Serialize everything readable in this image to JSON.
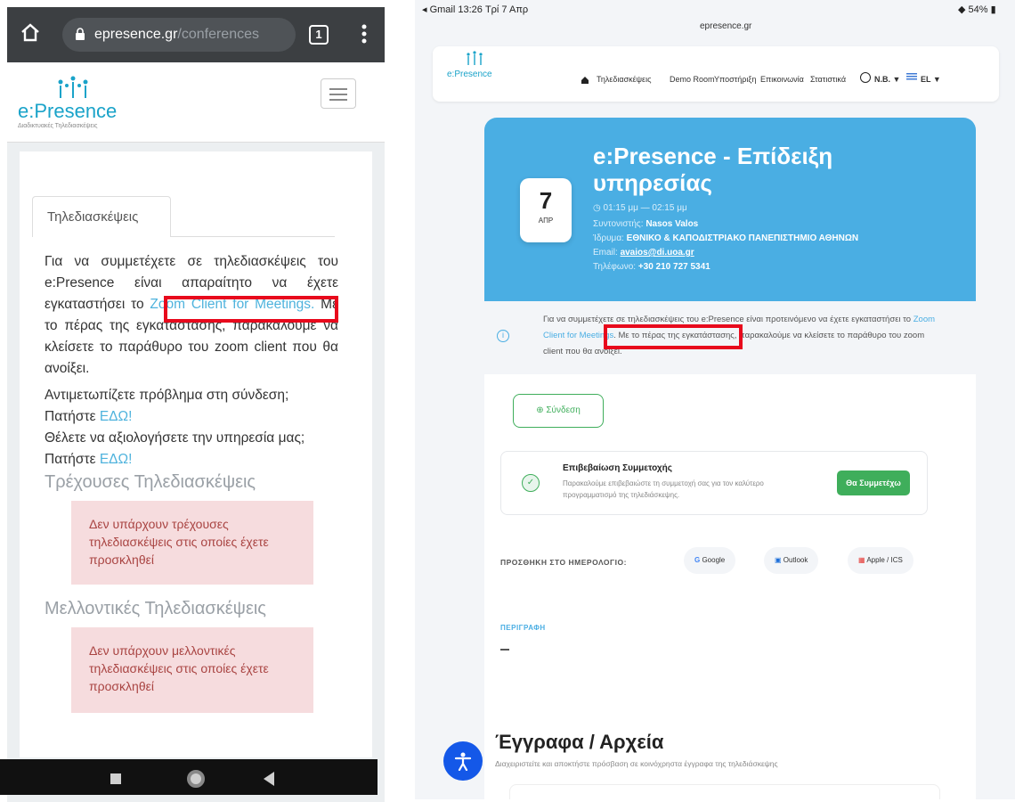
{
  "phone": {
    "browser": {
      "url_domain": "epresence.gr",
      "url_path": "/conferences",
      "tab_count": "1"
    },
    "logo": {
      "name": "e:Presence",
      "tagline": "Διαδικτυακές Τηλεδιασκέψεις"
    },
    "tab_label": "Τηλεδιασκέψεις",
    "intro": {
      "before_link": "Για να συμμετέχετε σε τηλεδιασκέψεις του e:Presence είναι απαραίτητο να έχετε εγκαταστήσει το ",
      "link": "Zoom Client for Meetings.",
      "after_link": " Με το πέρας της εγκατάστασης, παρακαλούμε να κλείσετε το παράθυρο του zoom client που θα ανοίξει."
    },
    "help": {
      "problem_text": "Αντιμετωπίζετε πρόβλημα στη σύνδεση;",
      "problem_press": "Πατήστε ",
      "problem_link": "ΕΔΩ!",
      "rate_text": "Θέλετε να αξιολογήσετε την υπηρεσία μας;",
      "rate_press": "Πατήστε ",
      "rate_link": "ΕΔΩ!"
    },
    "current_title": "Τρέχουσες Τηλεδιασκέψεις",
    "current_empty": "Δεν υπάρχουν τρέχουσες τηλεδιασκέψεις στις οποίες έχετε προσκληθεί",
    "future_title": "Μελλοντικές Τηλεδιασκέψεις",
    "future_empty": "Δεν υπάρχουν μελλοντικές τηλεδιασκέψεις στις οποίες έχετε προσκληθεί"
  },
  "tablet": {
    "status": {
      "left": "◂ Gmail 13:26 Τρί 7 Απρ",
      "right": "54%",
      "url": "epresence.gr"
    },
    "logo": "e:Presence",
    "nav": [
      "Τηλεδιασκέψεις",
      "Demo Room",
      "Υποστήριξη",
      "Επικοινωνία",
      "Στατιστικά",
      "N.B.",
      "EL"
    ],
    "event": {
      "day": "7",
      "month": "ΑΠΡ",
      "title": "e:Presence - Επίδειξη υπηρεσίας",
      "time": "01:15 μμ — 02:15 μμ",
      "coordinator_label": "Συντονιστής: ",
      "coordinator": "Nasos Valos",
      "institution_label": "Ίδρυμα: ",
      "institution": "ΕΘΝΙΚΟ & ΚΑΠΟΔΙΣΤΡΙΑΚΟ ΠΑΝΕΠΙΣΤΗΜΙΟ ΑΘΗΝΩΝ",
      "email_label": "Email: ",
      "email": "avaios@di.uoa.gr",
      "phone_label": "Τηλέφωνο: ",
      "phone": "+30 210 727 5341"
    },
    "info": {
      "before_link": "Για να συμμετέχετε σε τηλεδιασκέψεις του e:Presence είναι προτεινόμενο να έχετε εγκαταστήσει το ",
      "link": "Zoom Client for Meetings",
      "after_link": ". Με το πέρας της εγκατάστασης, παρακαλούμε να κλείσετε το παράθυρο του zoom client που θα ανοίξει."
    },
    "join_label": "Σύνδεση",
    "confirm": {
      "title": "Επιβεβαίωση Συμμετοχής",
      "text": "Παρακαλούμε επιβεβαιώστε τη συμμετοχή σας για τον καλύτερο προγραμματισμό της τηλεδιάσκεψης.",
      "button": "Θα Συμμετέχω"
    },
    "calendar": {
      "label": "ΠΡΟΣΘΗΚΗ ΣΤΟ ΗΜΕΡΟΛΟΓΙΟ:",
      "google": "Google",
      "outlook": "Outlook",
      "apple": "Apple / ICS"
    },
    "description_label": "ΠΕΡΙΓΡΑΦΗ",
    "files": {
      "title": "Έγγραφα / Αρχεία",
      "subtitle": "Διαχειριστείτε και αποκτήστε πρόσβαση σε κοινόχρηστα έγγραφα της τηλεδιάσκεψης"
    }
  },
  "colors": {
    "highlight": "#e8091c",
    "brand_blue": "#4aaee3",
    "success_green": "#3fae5b",
    "alert_bg": "#f6dcde"
  }
}
